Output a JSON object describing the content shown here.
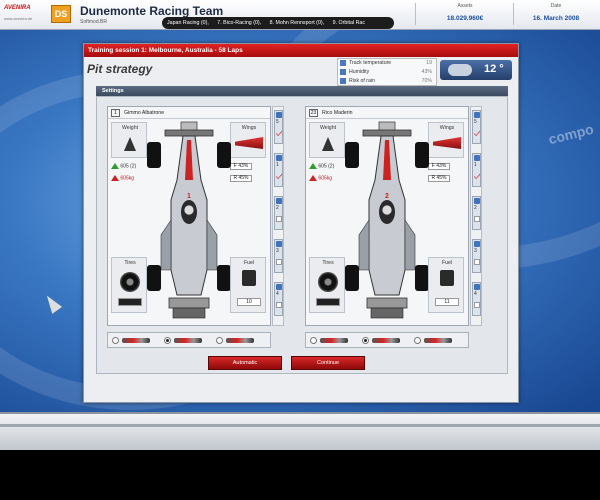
{
  "header": {
    "small_logo": "AVENIRA",
    "small_logo_sub": "www.avenira.de",
    "team_logo": "DS",
    "team_name": "Dunemonte Racing Team",
    "team_sub": "Softmod.BR",
    "ticker": [
      "Japan Racing (0),",
      "7. Bico-Racing (0),",
      "8. Mohn Rennsport (0),",
      "9. Orbital Rac"
    ],
    "assets_label": "Assets",
    "assets_value": "18.029.960€",
    "date_label": "Date",
    "date_value": "16. March 2008"
  },
  "window": {
    "title": "Training session 1: Melbourne, Australia - 58 Laps",
    "subtitle": "Pit strategy",
    "weather": [
      {
        "label": "Track temperature",
        "value": "19"
      },
      {
        "label": "Humidity",
        "value": "43%"
      },
      {
        "label": "Risk of rain",
        "value": "70%"
      }
    ],
    "temperature": "12 °",
    "settings_title": "Settings"
  },
  "drivers": [
    {
      "number": "1",
      "name": "Gimmo Albatrone",
      "weight_label": "Weight",
      "weight_a": "605 (2)",
      "weight_b": "605kg",
      "wings_label": "Wings",
      "wing_front": "F 43%",
      "wing_rear": "R 45%",
      "tires_label": "Tires",
      "fuel_label": "Fuel",
      "fuel_value": "10",
      "stints": [
        "5",
        "1",
        "2",
        "3",
        "4"
      ],
      "car_number": "1"
    },
    {
      "number": "23",
      "name": "Rico Maderin",
      "weight_label": "Weight",
      "weight_a": "605 (2)",
      "weight_b": "605kg",
      "wings_label": "Wings",
      "wing_front": "F 43%",
      "wing_rear": "R 45%",
      "tires_label": "Tires",
      "fuel_label": "Fuel",
      "fuel_value": "11",
      "stints": [
        "5",
        "1",
        "2",
        "3",
        "4"
      ],
      "car_number": "2"
    }
  ],
  "buttons": {
    "automatic": "Automatic",
    "continue": "Continue"
  },
  "colors": {
    "accent_red": "#d21e1e",
    "panel_bg": "#f5f6f8",
    "background_blue": "#3a78c4"
  }
}
